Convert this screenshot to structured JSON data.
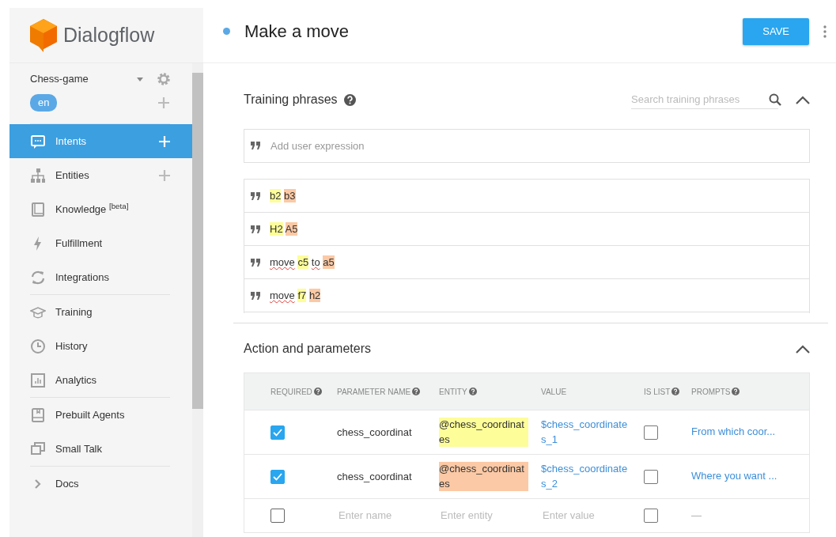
{
  "logo": {
    "text": "Dialogflow"
  },
  "agent": {
    "name": "Chess-game",
    "language": "en"
  },
  "sidebar": {
    "sections": [
      [
        {
          "kind": "chat",
          "label": "Intents",
          "selected": true,
          "addable": true
        },
        {
          "kind": "tree",
          "label": "Entities",
          "selected": false,
          "addable": true
        },
        {
          "kind": "book",
          "label": "Knowledge $^{[beta]}$",
          "selected": false,
          "addable": false
        },
        {
          "kind": "bolt",
          "label": "Fulfillment",
          "selected": false,
          "addable": false
        },
        {
          "kind": "sync",
          "label": "Integrations",
          "selected": false,
          "addable": false
        }
      ],
      [
        {
          "kind": "cap",
          "label": "Training",
          "selected": false,
          "addable": false
        },
        {
          "kind": "clock",
          "label": "History",
          "selected": false,
          "addable": false
        },
        {
          "kind": "chart",
          "label": "Analytics",
          "selected": false,
          "addable": false
        }
      ],
      [
        {
          "kind": "agent",
          "label": "Prebuilt Agents",
          "selected": false,
          "addable": false
        },
        {
          "kind": "talk",
          "label": "Small Talk",
          "selected": false,
          "addable": false
        }
      ],
      [
        {
          "kind": "chevron",
          "label": "Docs",
          "selected": false,
          "addable": false
        }
      ]
    ]
  },
  "intent": {
    "title": "Make a move",
    "button": "SAVE"
  },
  "training_phrases": {
    "title": "Training phrases",
    "placeholder": "Search training phrases",
    "input_placeholder": "Add user expression",
    "phrases": [
      {
        "segments": [
          {
            "text": "b2",
            "color": "#fdfd9a",
            "misspelled": false
          },
          {
            "text": "b3",
            "color": "#fbc9a5",
            "misspelled": false
          }
        ]
      },
      {
        "segments": [
          {
            "text": "H2",
            "color": "#fdfd9a",
            "misspelled": false
          },
          {
            "text": "A5",
            "color": "#fbc9a5",
            "misspelled": false
          }
        ]
      },
      {
        "segments": [
          {
            "text": "move",
            "misspelled": true
          },
          {
            "text": "c5",
            "color": "#fdfd9a",
            "misspelled": false
          },
          {
            "text": "to",
            "misspelled": true
          },
          {
            "text": "a5",
            "color": "#fbc9a5",
            "misspelled": false
          }
        ]
      },
      {
        "segments": [
          {
            "text": "move",
            "misspelled": true
          },
          {
            "text": "f7",
            "color": "#fdfd9a",
            "misspelled": false
          },
          {
            "text": "h2",
            "color": "#fbc9a5",
            "misspelled": false
          }
        ]
      }
    ]
  },
  "action_parameters": {
    "title": "Action and parameters",
    "columns": [
      {
        "label": "REQUIRED",
        "help": true
      },
      {
        "label": "PARAMETER NAME",
        "help": true
      },
      {
        "label": "ENTITY",
        "help": true
      },
      {
        "label": "VALUE",
        "help": false
      },
      {
        "label": "IS LIST",
        "help": true
      },
      {
        "label": "PROMPTS",
        "help": true
      }
    ],
    "rows": [
      {
        "kind": "param",
        "required": true,
        "name": "chess_coordinat",
        "entity": "@chess_coordinates",
        "color": "#fdfd9a",
        "value": "$chess_coordinates_1",
        "is_list": false,
        "prompts": "From which coor..."
      },
      {
        "kind": "param",
        "required": true,
        "name": "chess_coordinat",
        "entity": "@chess_coordinates",
        "color": "#fbc9a5",
        "value": "$chess_coordinates_2",
        "is_list": false,
        "prompts": "Where you want ..."
      },
      {
        "kind": "new",
        "required": false,
        "name": {
          "placeholder": "Enter name"
        },
        "entity": {
          "placeholder": "Enter entity"
        },
        "value": {
          "placeholder": "Enter value"
        },
        "is_list": false,
        "prompts": "—"
      }
    ]
  }
}
